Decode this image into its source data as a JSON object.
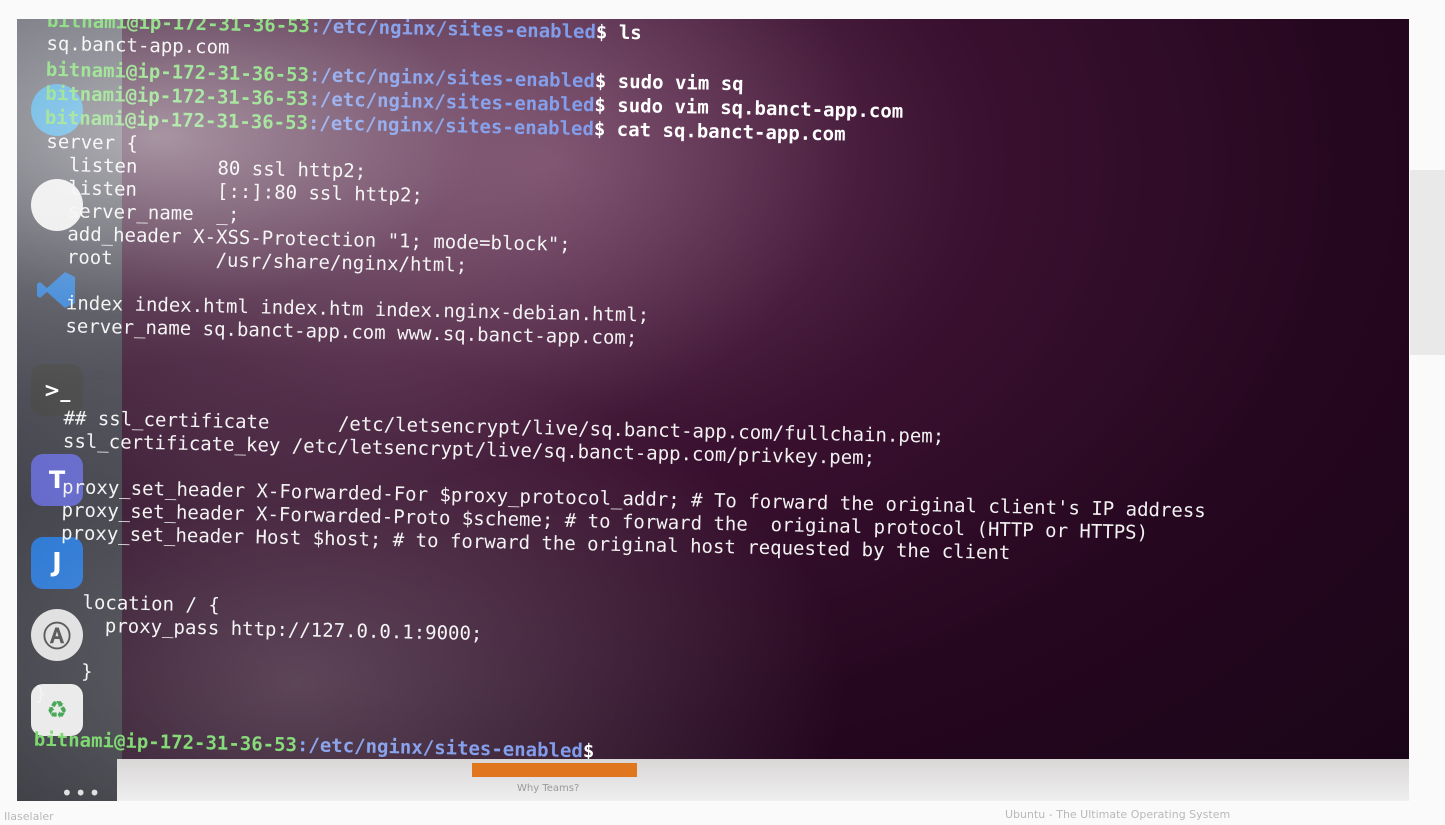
{
  "terminal": {
    "prompt": {
      "user_host": "bitnami@ip-172-31-36-53",
      "path": ":/etc/nginx/sites-enabled",
      "symbol": "$"
    },
    "history": [
      {
        "user_host": "bitnami@ip-172-31-36-53",
        "path": ":/etc/nginx/sites-enabled",
        "symbol": "$",
        "command": " ls"
      },
      {
        "output": "sq.banct-app.com"
      },
      {
        "user_host": "bitnami@ip-172-31-36-53",
        "path": ":/etc/nginx/sites-enabled",
        "symbol": "$",
        "command": " sudo vim sq"
      },
      {
        "user_host": "bitnami@ip-172-31-36-53",
        "path": ":/etc/nginx/sites-enabled",
        "symbol": "$",
        "command": " sudo vim sq.banct-app.com"
      },
      {
        "user_host": "bitnami@ip-172-31-36-53",
        "path": ":/etc/nginx/sites-enabled",
        "symbol": "$",
        "command": " cat sq.banct-app.com"
      }
    ],
    "config_lines": [
      "server {",
      "  listen       80 ssl http2;",
      "  listen       [::]:80 ssl http2;",
      "  server_name  _;",
      "  add_header X-XSS-Protection \"1; mode=block\";",
      "  root         /usr/share/nginx/html;",
      "",
      "  index index.html index.htm index.nginx-debian.html;",
      "  server_name sq.banct-app.com www.sq.banct-app.com;",
      "",
      "",
      "",
      "  ## ssl_certificate      /etc/letsencrypt/live/sq.banct-app.com/fullchain.pem;",
      "  ssl_certificate_key /etc/letsencrypt/live/sq.banct-app.com/privkey.pem;",
      "",
      "  proxy_set_header X-Forwarded-For $proxy_protocol_addr; # To forward the original client's IP address",
      "  proxy_set_header X-Forwarded-Proto $scheme; # to forward the  original protocol (HTTP or HTTPS)",
      "  proxy_set_header Host $host; # to forward the original host requested by the client",
      "",
      "",
      "",
      "    location / {",
      "      proxy_pass http://127.0.0.1:9000;",
      "",
      "    }",
      "}"
    ]
  },
  "bezel": {
    "text": "Why Teams?"
  },
  "background": {
    "bottom_left": "Ilaselaler",
    "bottom_right": "Ubuntu - The Ultimate Operating System"
  },
  "dock": {
    "apps": [
      {
        "icon": "chrome-icon",
        "color": "#2f9bd8"
      },
      {
        "icon": "vscode-icon",
        "color": "#2a7ad1"
      },
      {
        "icon": "terminal-icon",
        "color": "#3a3a3a"
      },
      {
        "icon": "teams-icon",
        "color": "#5b5fc7"
      },
      {
        "icon": "joplin-icon",
        "color": "#1e6fd1"
      },
      {
        "icon": "appcenter-icon",
        "color": "#dddddd"
      },
      {
        "icon": "trash-icon",
        "color": "#e8e8e8"
      }
    ]
  }
}
